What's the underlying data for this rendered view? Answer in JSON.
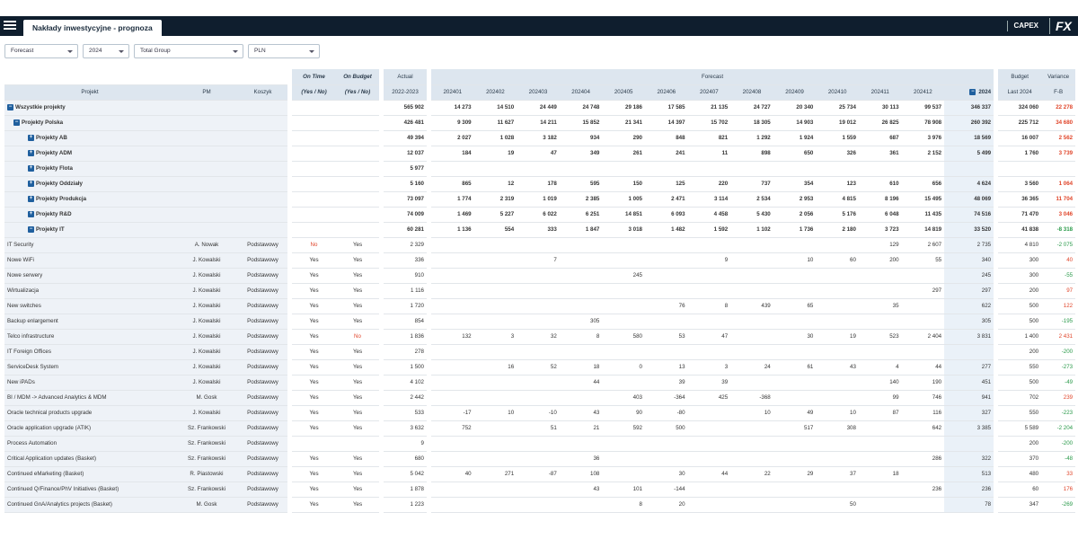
{
  "header": {
    "tab_title": "Nakłady inwestycyjne - prognoza",
    "capex_label": "CAPEX",
    "logo_text": "FX"
  },
  "filters": {
    "scenario": "Forecast",
    "year": "2024",
    "group": "Total Group",
    "currency": "PLN"
  },
  "columns": {
    "projekt": "Projekt",
    "pm": "PM",
    "koszyk": "Koszyk",
    "on_time": "On Time",
    "on_time_sub": "(Yes / No)",
    "on_budget": "On Budget",
    "on_budget_sub": "(Yes / No)",
    "actual": "Actual",
    "actual_sub": "2022-2023",
    "forecast": "Forecast",
    "months": [
      "202401",
      "202402",
      "202403",
      "202404",
      "202405",
      "202406",
      "202407",
      "202408",
      "202409",
      "202410",
      "202411",
      "202412"
    ],
    "total": "2024",
    "budget": "Budget",
    "budget_sub": "Last 2024",
    "variance": "Variance",
    "variance_sub": "F-B"
  },
  "rows": [
    {
      "name": "Wszystkie projekty",
      "level": 1,
      "box": "−",
      "pm": "",
      "koszyk": "",
      "ot": "",
      "ob": "",
      "actual": "565 902",
      "m": [
        "14 273",
        "14 510",
        "24 449",
        "24 748",
        "29 186",
        "17 585",
        "21 135",
        "24 727",
        "20 340",
        "25 734",
        "30 113",
        "99 537"
      ],
      "total": "346 337",
      "budget": "324 060",
      "variance": "22 278",
      "vsign": "pos",
      "bold": true
    },
    {
      "name": "Projekty Polska",
      "level": 2,
      "box": "−",
      "pm": "",
      "koszyk": "",
      "ot": "",
      "ob": "",
      "actual": "426 481",
      "m": [
        "9 309",
        "11 627",
        "14 211",
        "15 852",
        "21 341",
        "14 397",
        "15 702",
        "18 305",
        "14 903",
        "19 012",
        "26 825",
        "78 908"
      ],
      "total": "260 392",
      "budget": "225 712",
      "variance": "34 680",
      "vsign": "pos",
      "bold": true
    },
    {
      "name": "Projekty AB",
      "level": 3,
      "box": "+",
      "pm": "",
      "koszyk": "",
      "ot": "",
      "ob": "",
      "actual": "49 394",
      "m": [
        "2 027",
        "1 028",
        "3 182",
        "934",
        "290",
        "848",
        "821",
        "1 292",
        "1 924",
        "1 559",
        "687",
        "3 976"
      ],
      "total": "18 569",
      "budget": "16 007",
      "variance": "2 562",
      "vsign": "pos",
      "bold": true
    },
    {
      "name": "Projekty ADM",
      "level": 3,
      "box": "+",
      "pm": "",
      "koszyk": "",
      "ot": "",
      "ob": "",
      "actual": "12 037",
      "m": [
        "184",
        "19",
        "47",
        "349",
        "261",
        "241",
        "11",
        "898",
        "650",
        "326",
        "361",
        "2 152"
      ],
      "total": "5 499",
      "budget": "1 760",
      "variance": "3 739",
      "vsign": "pos",
      "bold": true
    },
    {
      "name": "Projekty Flota",
      "level": 3,
      "box": "+",
      "pm": "",
      "koszyk": "",
      "ot": "",
      "ob": "",
      "actual": "5 977",
      "m": [
        "",
        "",
        "",
        "",
        "",
        "",
        "",
        "",
        "",
        "",
        "",
        ""
      ],
      "total": "",
      "budget": "",
      "variance": "",
      "vsign": "",
      "bold": true
    },
    {
      "name": "Projekty Oddziały",
      "level": 3,
      "box": "+",
      "pm": "",
      "koszyk": "",
      "ot": "",
      "ob": "",
      "actual": "5 160",
      "m": [
        "865",
        "12",
        "178",
        "595",
        "150",
        "125",
        "220",
        "737",
        "354",
        "123",
        "610",
        "656"
      ],
      "total": "4 624",
      "budget": "3 560",
      "variance": "1 064",
      "vsign": "pos",
      "bold": true
    },
    {
      "name": "Projekty Produkcja",
      "level": 3,
      "box": "+",
      "pm": "",
      "koszyk": "",
      "ot": "",
      "ob": "",
      "actual": "73 097",
      "m": [
        "1 774",
        "2 319",
        "1 019",
        "2 385",
        "1 005",
        "2 471",
        "3 114",
        "2 534",
        "2 953",
        "4 815",
        "8 196",
        "15 495"
      ],
      "total": "48 069",
      "budget": "36 365",
      "variance": "11 704",
      "vsign": "pos",
      "bold": true
    },
    {
      "name": "Projekty R&D",
      "level": 3,
      "box": "+",
      "pm": "",
      "koszyk": "",
      "ot": "",
      "ob": "",
      "actual": "74 009",
      "m": [
        "1 469",
        "5 227",
        "6 022",
        "6 251",
        "14 851",
        "6 093",
        "4 458",
        "5 430",
        "2 056",
        "5 176",
        "6 048",
        "11 435"
      ],
      "total": "74 516",
      "budget": "71 470",
      "variance": "3 046",
      "vsign": "pos",
      "bold": true
    },
    {
      "name": "Projekty IT",
      "level": 3,
      "box": "−",
      "pm": "",
      "koszyk": "",
      "ot": "",
      "ob": "",
      "actual": "60 281",
      "m": [
        "1 136",
        "554",
        "333",
        "1 847",
        "3 018",
        "1 482",
        "1 592",
        "1 102",
        "1 736",
        "2 180",
        "3 723",
        "14 819"
      ],
      "total": "33 520",
      "budget": "41 838",
      "variance": "-8 318",
      "vsign": "neg",
      "bold": true
    },
    {
      "name": "IT Security",
      "level": 4,
      "box": "",
      "pm": "A. Nowak",
      "koszyk": "Podstawowy",
      "ot": "No",
      "ob": "Yes",
      "actual": "2 329",
      "m": [
        "",
        "",
        "",
        "",
        "",
        "",
        "",
        "",
        "",
        "",
        "129",
        "2 607"
      ],
      "total": "2 735",
      "budget": "4 810",
      "variance": "-2 075",
      "vsign": "neg",
      "bold": false
    },
    {
      "name": "Nowe WiFi",
      "level": 4,
      "box": "",
      "pm": "J. Kowalski",
      "koszyk": "Podstawowy",
      "ot": "Yes",
      "ob": "Yes",
      "actual": "336",
      "m": [
        "",
        "",
        "7",
        "",
        "",
        "",
        "9",
        "",
        "10",
        "60",
        "200",
        "55"
      ],
      "total": "340",
      "budget": "300",
      "variance": "40",
      "vsign": "pos",
      "bold": false
    },
    {
      "name": "Nowe serwery",
      "level": 4,
      "box": "",
      "pm": "J. Kowalski",
      "koszyk": "Podstawowy",
      "ot": "Yes",
      "ob": "Yes",
      "actual": "910",
      "m": [
        "",
        "",
        "",
        "",
        "245",
        "",
        "",
        "",
        "",
        "",
        "",
        ""
      ],
      "total": "245",
      "budget": "300",
      "variance": "-55",
      "vsign": "neg",
      "bold": false
    },
    {
      "name": "Wirtualizacja",
      "level": 4,
      "box": "",
      "pm": "J. Kowalski",
      "koszyk": "Podstawowy",
      "ot": "Yes",
      "ob": "Yes",
      "actual": "1 116",
      "m": [
        "",
        "",
        "",
        "",
        "",
        "",
        "",
        "",
        "",
        "",
        "",
        "297"
      ],
      "total": "297",
      "budget": "200",
      "variance": "97",
      "vsign": "pos",
      "bold": false
    },
    {
      "name": "New switches",
      "level": 4,
      "box": "",
      "pm": "J. Kowalski",
      "koszyk": "Podstawowy",
      "ot": "Yes",
      "ob": "Yes",
      "actual": "1 720",
      "m": [
        "",
        "",
        "",
        "",
        "",
        "76",
        "8",
        "439",
        "65",
        "",
        "35",
        ""
      ],
      "total": "622",
      "budget": "500",
      "variance": "122",
      "vsign": "pos",
      "bold": false
    },
    {
      "name": "Backup enlargement",
      "level": 4,
      "box": "",
      "pm": "J. Kowalski",
      "koszyk": "Podstawowy",
      "ot": "Yes",
      "ob": "Yes",
      "actual": "854",
      "m": [
        "",
        "",
        "",
        "305",
        "",
        "",
        "",
        "",
        "",
        "",
        "",
        ""
      ],
      "total": "305",
      "budget": "500",
      "variance": "-195",
      "vsign": "neg",
      "bold": false
    },
    {
      "name": "Telco infrastructure",
      "level": 4,
      "box": "",
      "pm": "J. Kowalski",
      "koszyk": "Podstawowy",
      "ot": "Yes",
      "ob": "No",
      "actual": "1 836",
      "m": [
        "132",
        "3",
        "32",
        "8",
        "580",
        "53",
        "47",
        "",
        "30",
        "19",
        "523",
        "2 404"
      ],
      "total": "3 831",
      "budget": "1 400",
      "variance": "2 431",
      "vsign": "pos",
      "bold": false
    },
    {
      "name": "IT Foreign Offices",
      "level": 4,
      "box": "",
      "pm": "J. Kowalski",
      "koszyk": "Podstawowy",
      "ot": "Yes",
      "ob": "Yes",
      "actual": "278",
      "m": [
        "",
        "",
        "",
        "",
        "",
        "",
        "",
        "",
        "",
        "",
        "",
        ""
      ],
      "total": "",
      "budget": "200",
      "variance": "-200",
      "vsign": "neg",
      "bold": false
    },
    {
      "name": "ServiceDesk System",
      "level": 4,
      "box": "",
      "pm": "J. Kowalski",
      "koszyk": "Podstawowy",
      "ot": "Yes",
      "ob": "Yes",
      "actual": "1 500",
      "m": [
        "",
        "16",
        "52",
        "18",
        "0",
        "13",
        "3",
        "24",
        "61",
        "43",
        "4",
        "44"
      ],
      "total": "277",
      "budget": "550",
      "variance": "-273",
      "vsign": "neg",
      "bold": false
    },
    {
      "name": "New iPADs",
      "level": 4,
      "box": "",
      "pm": "J. Kowalski",
      "koszyk": "Podstawowy",
      "ot": "Yes",
      "ob": "Yes",
      "actual": "4 102",
      "m": [
        "",
        "",
        "",
        "44",
        "",
        "39",
        "39",
        "",
        "",
        "",
        "140",
        "190"
      ],
      "total": "451",
      "budget": "500",
      "variance": "-49",
      "vsign": "neg",
      "bold": false
    },
    {
      "name": "BI / MDM -> Advanced Analytics & MDM",
      "level": 4,
      "box": "",
      "pm": "M. Gosk",
      "koszyk": "Podstawowy",
      "ot": "Yes",
      "ob": "Yes",
      "actual": "2 442",
      "m": [
        "",
        "",
        "",
        "",
        "403",
        "-364",
        "425",
        "-368",
        "",
        "",
        "99",
        "746"
      ],
      "total": "941",
      "budget": "702",
      "variance": "239",
      "vsign": "pos",
      "bold": false
    },
    {
      "name": "Oracle technical products upgrade",
      "level": 4,
      "box": "",
      "pm": "J. Kowalski",
      "koszyk": "Podstawowy",
      "ot": "Yes",
      "ob": "Yes",
      "actual": "533",
      "m": [
        "-17",
        "10",
        "-10",
        "43",
        "90",
        "-80",
        "",
        "10",
        "49",
        "10",
        "87",
        "116"
      ],
      "total": "327",
      "budget": "550",
      "variance": "-223",
      "vsign": "neg",
      "bold": false
    },
    {
      "name": "Oracle application upgrade (ATIK)",
      "level": 4,
      "box": "",
      "pm": "Sz. Frankowski",
      "koszyk": "Podstawowy",
      "ot": "Yes",
      "ob": "Yes",
      "actual": "3 632",
      "m": [
        "752",
        "",
        "51",
        "21",
        "592",
        "500",
        "",
        "",
        "517",
        "308",
        "",
        "642"
      ],
      "total": "3 385",
      "budget": "5 589",
      "variance": "-2 204",
      "vsign": "neg",
      "bold": false
    },
    {
      "name": "Process Automation",
      "level": 4,
      "box": "",
      "pm": "Sz. Frankowski",
      "koszyk": "Podstawowy",
      "ot": "",
      "ob": "",
      "actual": "9",
      "m": [
        "",
        "",
        "",
        "",
        "",
        "",
        "",
        "",
        "",
        "",
        "",
        ""
      ],
      "total": "",
      "budget": "200",
      "variance": "-200",
      "vsign": "neg",
      "bold": false
    },
    {
      "name": "Critical Application updates (Basket)",
      "level": 4,
      "box": "",
      "pm": "Sz. Frankowski",
      "koszyk": "Podstawowy",
      "ot": "Yes",
      "ob": "Yes",
      "actual": "680",
      "m": [
        "",
        "",
        "",
        "36",
        "",
        "",
        "",
        "",
        "",
        "",
        "",
        "286"
      ],
      "total": "322",
      "budget": "370",
      "variance": "-48",
      "vsign": "neg",
      "bold": false
    },
    {
      "name": "Continued eMarketing (Basket)",
      "level": 4,
      "box": "",
      "pm": "R. Piastowski",
      "koszyk": "Podstawowy",
      "ot": "Yes",
      "ob": "Yes",
      "actual": "5 042",
      "m": [
        "40",
        "271",
        "-87",
        "108",
        "",
        "30",
        "44",
        "22",
        "29",
        "37",
        "18",
        ""
      ],
      "total": "513",
      "budget": "480",
      "variance": "33",
      "vsign": "pos",
      "bold": false
    },
    {
      "name": "Continued Q/Finance/PhV Initiatives (Basket)",
      "level": 4,
      "box": "",
      "pm": "Sz. Frankowski",
      "koszyk": "Podstawowy",
      "ot": "Yes",
      "ob": "Yes",
      "actual": "1 878",
      "m": [
        "",
        "",
        "",
        "43",
        "101",
        "-144",
        "",
        "",
        "",
        "",
        "",
        "236"
      ],
      "total": "236",
      "budget": "60",
      "variance": "176",
      "vsign": "pos",
      "bold": false
    },
    {
      "name": "Continued GnA/Analytics projects (Basket)",
      "level": 4,
      "box": "",
      "pm": "M. Gosk",
      "koszyk": "Podstawowy",
      "ot": "Yes",
      "ob": "Yes",
      "actual": "1 223",
      "m": [
        "",
        "",
        "",
        "",
        "8",
        "20",
        "",
        "",
        "",
        "50",
        "",
        ""
      ],
      "total": "78",
      "budget": "347",
      "variance": "-269",
      "vsign": "neg",
      "bold": false
    }
  ]
}
